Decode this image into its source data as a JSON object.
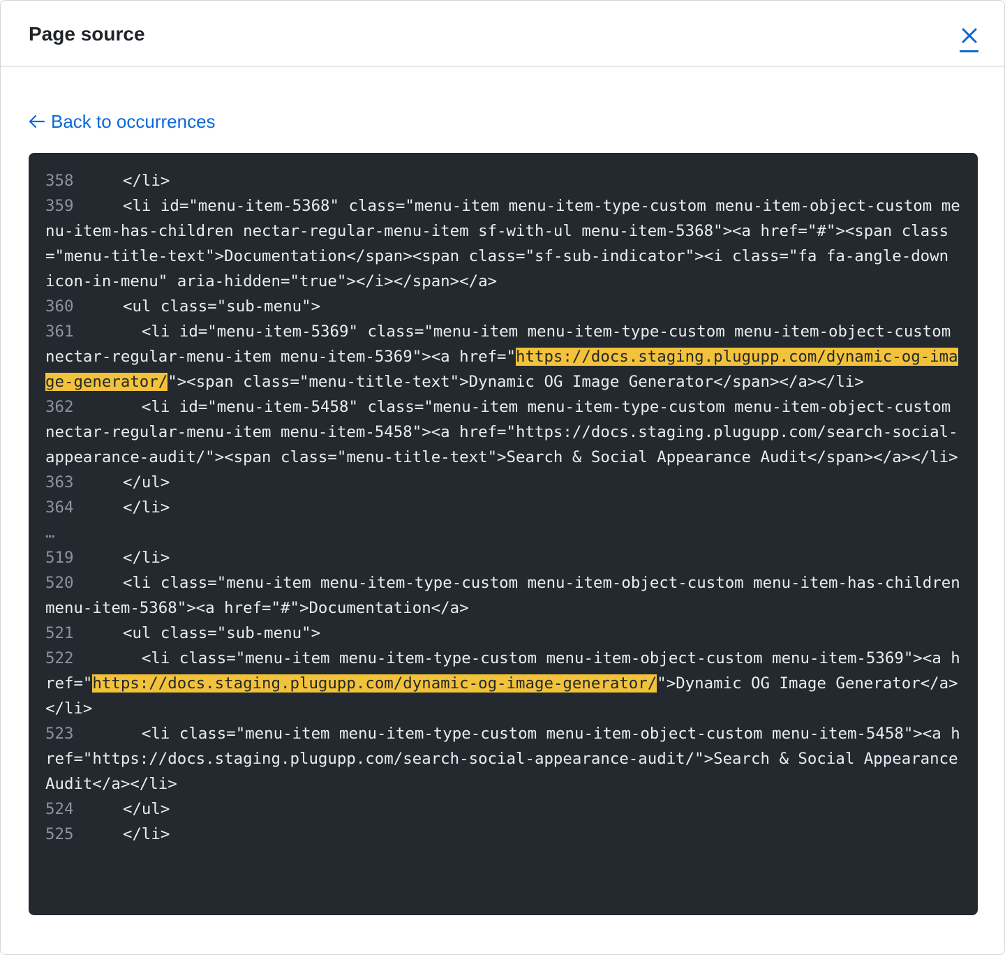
{
  "header": {
    "title": "Page source",
    "close_icon": "close-icon"
  },
  "back_link": {
    "label": "Back to occurrences",
    "icon": "arrow-left-icon"
  },
  "colors": {
    "link": "#0969da",
    "code_bg": "#24292f",
    "highlight": "#f2c23a",
    "line_number": "#8b949e"
  },
  "code_lines": [
    {
      "num": "358",
      "segments": [
        {
          "text": "  </li>"
        }
      ]
    },
    {
      "num": "359",
      "segments": [
        {
          "text": "  <li id=\"menu-item-5368\" class=\"menu-item menu-item-type-custom menu-item-object-custom menu-item-has-children nectar-regular-menu-item sf-with-ul menu-item-5368\"><a href=\"#\"><span class=\"menu-title-text\">Documentation</span><span class=\"sf-sub-indicator\"><i class=\"fa fa-angle-down icon-in-menu\" aria-hidden=\"true\"></i></span></a>"
        }
      ]
    },
    {
      "num": "360",
      "segments": [
        {
          "text": "  <ul class=\"sub-menu\">"
        }
      ]
    },
    {
      "num": "361",
      "segments": [
        {
          "text": "    <li id=\"menu-item-5369\" class=\"menu-item menu-item-type-custom menu-item-object-custom nectar-regular-menu-item menu-item-5369\"><a href=\""
        },
        {
          "text": "https://docs.staging.plugupp.com/dynamic-og-image-generator/",
          "hl": true
        },
        {
          "text": "\"><span class=\"menu-title-text\">Dynamic OG Image Generator</span></a></li>"
        }
      ]
    },
    {
      "num": "362",
      "segments": [
        {
          "text": "    <li id=\"menu-item-5458\" class=\"menu-item menu-item-type-custom menu-item-object-custom nectar-regular-menu-item menu-item-5458\"><a href=\"https://docs.staging.plugupp.com/search-social-appearance-audit/\"><span class=\"menu-title-text\">Search & Social Appearance Audit</span></a></li>"
        }
      ]
    },
    {
      "num": "363",
      "segments": [
        {
          "text": "  </ul>"
        }
      ]
    },
    {
      "num": "364",
      "segments": [
        {
          "text": "  </li>"
        }
      ]
    },
    {
      "num": "",
      "ellipsis": "…"
    },
    {
      "num": "519",
      "segments": [
        {
          "text": "  </li>"
        }
      ]
    },
    {
      "num": "520",
      "segments": [
        {
          "text": "  <li class=\"menu-item menu-item-type-custom menu-item-object-custom menu-item-has-children menu-item-5368\"><a href=\"#\">Documentation</a>"
        }
      ]
    },
    {
      "num": "521",
      "segments": [
        {
          "text": "  <ul class=\"sub-menu\">"
        }
      ]
    },
    {
      "num": "522",
      "segments": [
        {
          "text": "    <li class=\"menu-item menu-item-type-custom menu-item-object-custom menu-item-5369\"><a href=\""
        },
        {
          "text": "https://docs.staging.plugupp.com/dynamic-og-image-generator/",
          "hl": true
        },
        {
          "text": "\">Dynamic OG Image Generator</a></li>"
        }
      ]
    },
    {
      "num": "523",
      "segments": [
        {
          "text": "    <li class=\"menu-item menu-item-type-custom menu-item-object-custom menu-item-5458\"><a href=\"https://docs.staging.plugupp.com/search-social-appearance-audit/\">Search & Social Appearance Audit</a></li>"
        }
      ]
    },
    {
      "num": "524",
      "segments": [
        {
          "text": "  </ul>"
        }
      ]
    },
    {
      "num": "525",
      "segments": [
        {
          "text": "  </li>"
        }
      ]
    }
  ]
}
